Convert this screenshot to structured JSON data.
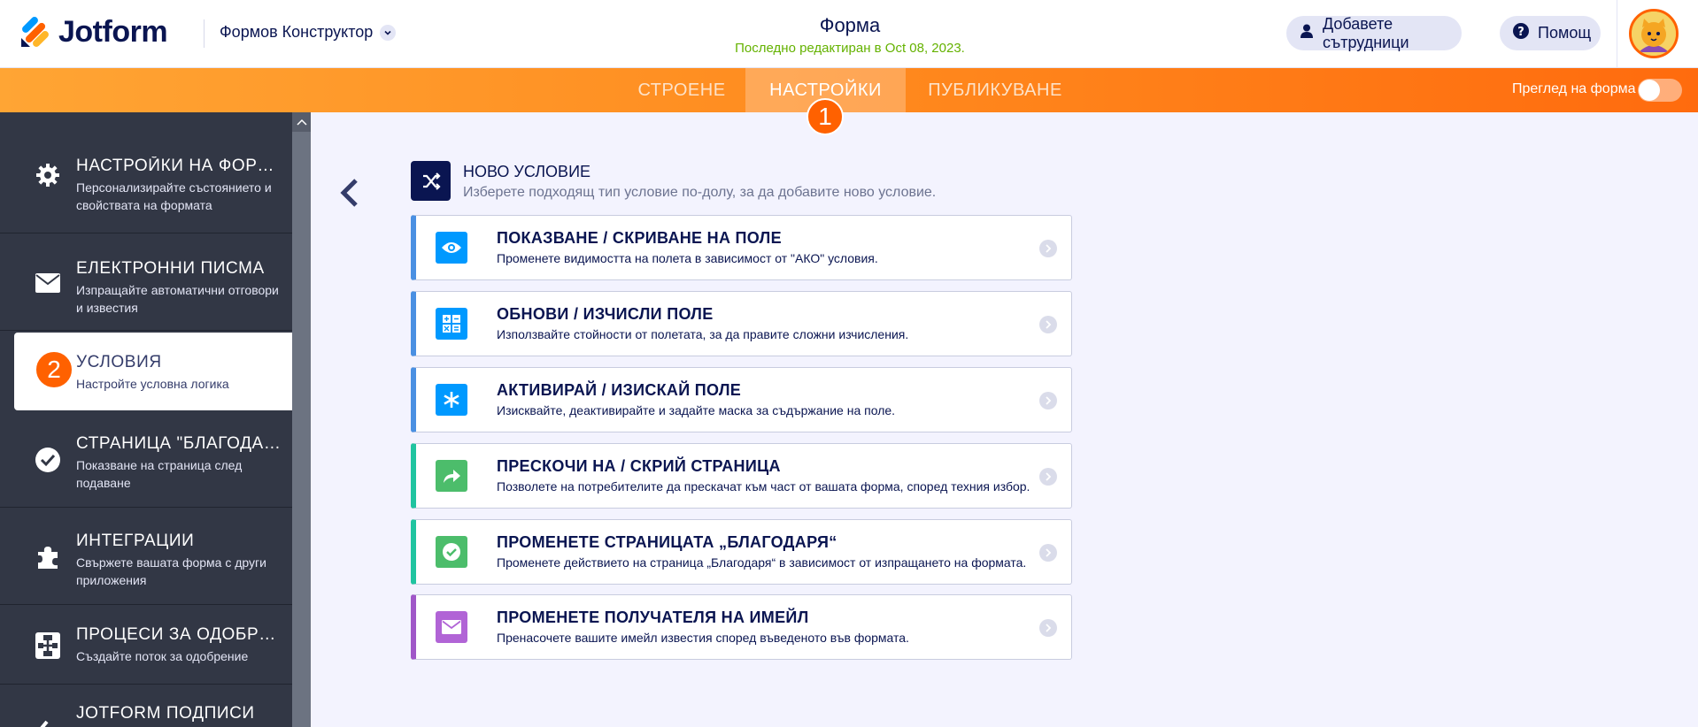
{
  "header": {
    "logo_text": "Jotform",
    "builder_menu_label": "Формов Конструктор",
    "form_title": "Форма",
    "form_subtitle": "Последно редактиран в Oct 08, 2023.",
    "collaborators_label": "Добавете сътрудници",
    "help_label": "Помощ"
  },
  "nav": {
    "tabs": [
      {
        "label": "СТРОЕНЕ",
        "active": false
      },
      {
        "label": "НАСТРОЙКИ",
        "active": true
      },
      {
        "label": "ПУБЛИКУВАНЕ",
        "active": false
      }
    ],
    "badge_1": "1",
    "preview_label": "Преглед на форма"
  },
  "sidebar": {
    "badge_2": "2",
    "items": [
      {
        "icon": "gear-icon",
        "title": "НАСТРОЙКИ НА ФОРМАТА",
        "desc": "Персонализирайте състоянието и свойствата на формата"
      },
      {
        "icon": "envelope-icon",
        "title": "ЕЛЕКТРОННИ ПИСМА",
        "desc": "Изпращайте автоматични отговори и известия"
      },
      {
        "icon": "conditions-icon",
        "title": "УСЛОВИЯ",
        "desc": "Настройте условна логика",
        "active": true
      },
      {
        "icon": "check-circle-icon",
        "title": "СТРАНИЦА \"БЛАГОДАРЯ\"",
        "desc": "Показване на страница след подаване"
      },
      {
        "icon": "puzzle-icon",
        "title": "ИНТЕГРАЦИИ",
        "desc": "Свържете вашата форма с други приложения"
      },
      {
        "icon": "workflow-icon",
        "title": "ПРОЦЕСИ ЗА ОДОБРЕНИЕ",
        "desc": "Създайте поток за одобрение"
      },
      {
        "icon": "sign-icon",
        "title": "JOTFORM ПОДПИСИ",
        "desc": ""
      }
    ]
  },
  "main": {
    "new_condition_title": "НОВО УСЛОВИЕ",
    "new_condition_subtitle": "Изберете подходящ тип условие по-долу, за да добавите ново условие.",
    "cards": [
      {
        "icon": "eye-icon",
        "color": "#0099ff",
        "border": "#4a90e2",
        "title": "ПОКАЗВАНЕ / СКРИВАНЕ НА ПОЛЕ",
        "desc": "Променете видимостта на полета в зависимост от \"АКО\" условия."
      },
      {
        "icon": "calculator-icon",
        "color": "#0099ff",
        "border": "#4a90e2",
        "title": "ОБНОВИ / ИЗЧИСЛИ ПОЛЕ",
        "desc": "Използвайте стойности от полетата, за да правите сложни изчисления."
      },
      {
        "icon": "asterisk-icon",
        "color": "#0099ff",
        "border": "#4a90e2",
        "title": "АКТИВИРАЙ / ИЗИСКАЙ ПОЛЕ",
        "desc": "Изисквайте, деактивирайте и задайте маска за съдържание на поле."
      },
      {
        "icon": "share-arrow-icon",
        "color": "#4cbd6b",
        "border": "#20c4a0",
        "title": "ПРЕСКОЧИ НА / СКРИЙ СТРАНИЦА",
        "desc": "Позволете на потребителите да прескачат към част от вашата форма, според техния избор."
      },
      {
        "icon": "check-icon",
        "color": "#4cbd6b",
        "border": "#20c4a0",
        "title": "ПРОМЕНЕТЕ СТРАНИЦАТА „БЛАГОДАРЯ“",
        "desc": "Променете действието на страница „Благодаря“ в зависимост от изпращането на формата."
      },
      {
        "icon": "mail-icon",
        "color": "#b164d6",
        "border": "#a057c8",
        "title": "ПРОМЕНЕТЕ ПОЛУЧАТЕЛЯ НА ИМЕЙЛ",
        "desc": "Пренасочете вашите имейл известия според въведеното във формата."
      }
    ]
  }
}
